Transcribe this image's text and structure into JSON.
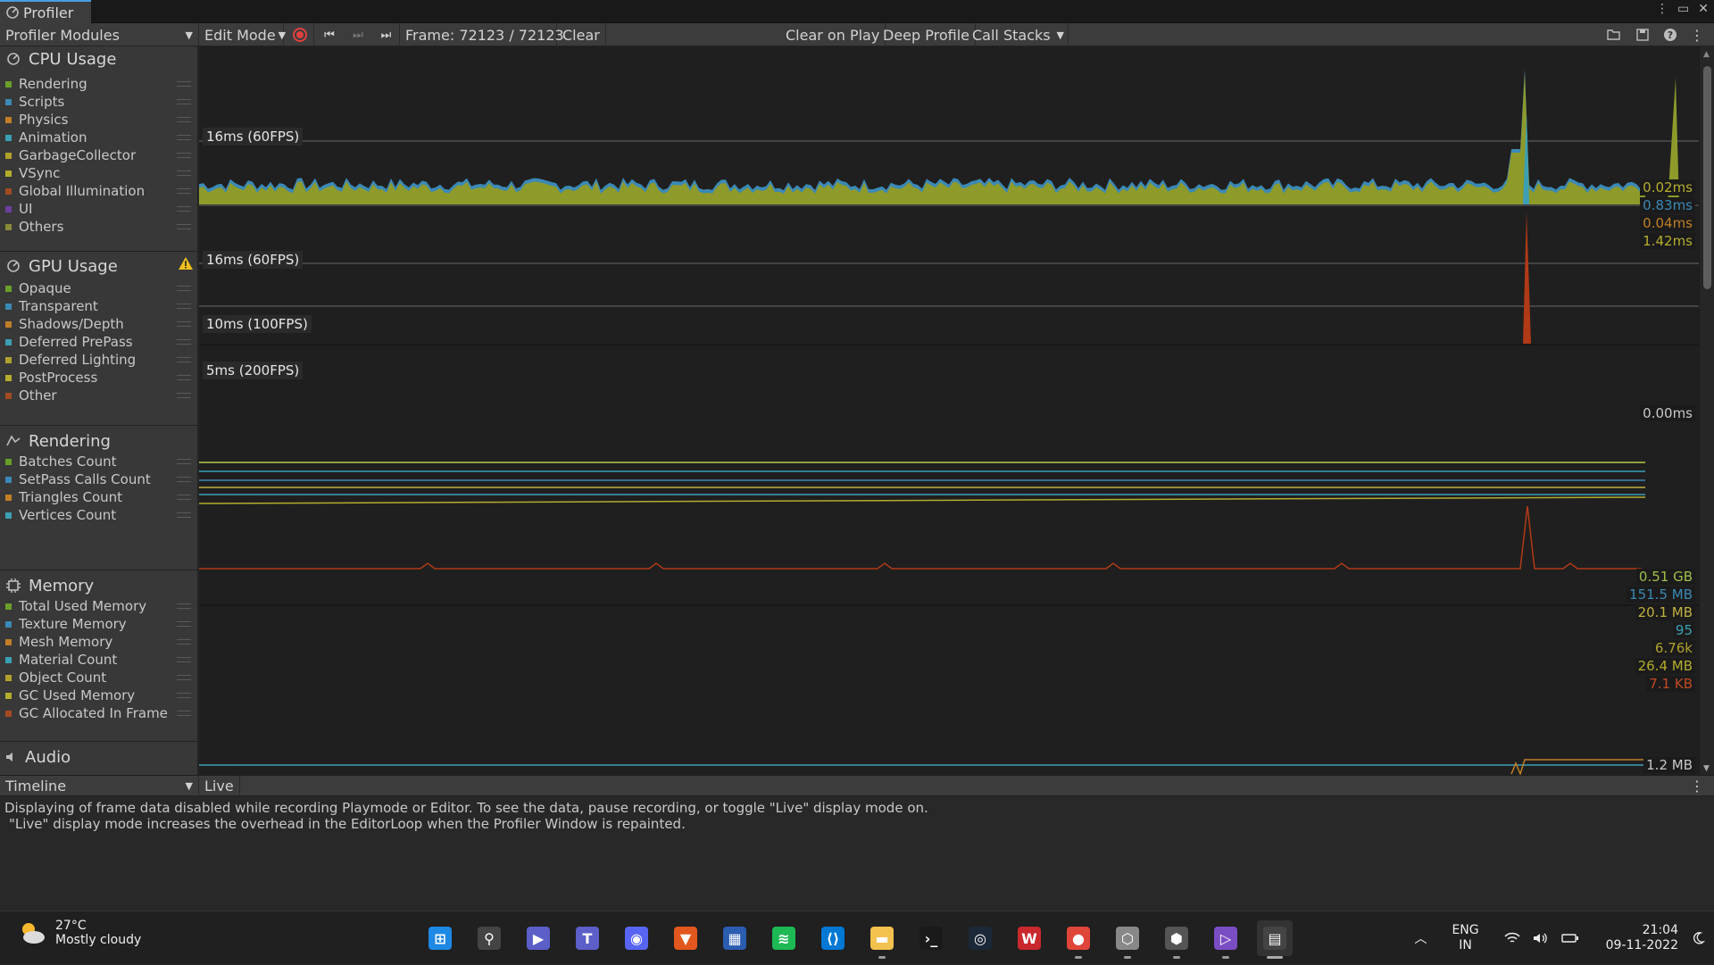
{
  "window": {
    "tab_title": "Profiler"
  },
  "toolbar": {
    "modules_label": "Profiler Modules",
    "mode_label": "Edit Mode",
    "frame_label": "Frame: 72123 / 72123",
    "clear_label": "Clear",
    "clear_on_play_label": "Clear on Play",
    "deep_profile_label": "Deep Profile",
    "call_stacks_label": "Call Stacks"
  },
  "modules": {
    "cpu": {
      "title": "CPU Usage",
      "items": [
        {
          "label": "Rendering",
          "color": "#6a9f2a"
        },
        {
          "label": "Scripts",
          "color": "#3b89b6"
        },
        {
          "label": "Physics",
          "color": "#c07f27"
        },
        {
          "label": "Animation",
          "color": "#3b9fb5"
        },
        {
          "label": "GarbageCollector",
          "color": "#b0a02c"
        },
        {
          "label": "VSync",
          "color": "#b4ad2e"
        },
        {
          "label": "Global Illumination",
          "color": "#a34a21"
        },
        {
          "label": "UI",
          "color": "#6b3fa0"
        },
        {
          "label": "Others",
          "color": "#8a8a3a"
        }
      ]
    },
    "gpu": {
      "title": "GPU Usage",
      "items": [
        {
          "label": "Opaque",
          "color": "#6a9f2a"
        },
        {
          "label": "Transparent",
          "color": "#3b89b6"
        },
        {
          "label": "Shadows/Depth",
          "color": "#c07f27"
        },
        {
          "label": "Deferred PrePass",
          "color": "#3b9fb5"
        },
        {
          "label": "Deferred Lighting",
          "color": "#b0a02c"
        },
        {
          "label": "PostProcess",
          "color": "#b4ad2e"
        },
        {
          "label": "Other",
          "color": "#a34a21"
        }
      ]
    },
    "rendering": {
      "title": "Rendering",
      "items": [
        {
          "label": "Batches Count",
          "color": "#6a9f2a"
        },
        {
          "label": "SetPass Calls Count",
          "color": "#3b89b6"
        },
        {
          "label": "Triangles Count",
          "color": "#c07f27"
        },
        {
          "label": "Vertices Count",
          "color": "#3b9fb5"
        }
      ]
    },
    "memory": {
      "title": "Memory",
      "items": [
        {
          "label": "Total Used Memory",
          "color": "#6a9f2a"
        },
        {
          "label": "Texture Memory",
          "color": "#3b89b6"
        },
        {
          "label": "Mesh Memory",
          "color": "#c07f27"
        },
        {
          "label": "Material Count",
          "color": "#3b9fb5"
        },
        {
          "label": "Object Count",
          "color": "#b0a02c"
        },
        {
          "label": "GC Used Memory",
          "color": "#b4ad2e"
        },
        {
          "label": "GC Allocated In Frame",
          "color": "#a34a21"
        }
      ]
    },
    "audio": {
      "title": "Audio"
    }
  },
  "graphs": {
    "cpu_ref": "16ms (60FPS)",
    "cpu_values": [
      {
        "text": "0.02ms",
        "color": "#b4ad2e"
      },
      {
        "text": "0.83ms",
        "color": "#3b89b6"
      },
      {
        "text": "0.04ms",
        "color": "#c07f27"
      },
      {
        "text": "1.42ms",
        "color": "#b4ad2e"
      }
    ],
    "gpu_refs": [
      "16ms (60FPS)",
      "10ms (100FPS)",
      "5ms (200FPS)"
    ],
    "gpu_value": {
      "text": "0.00ms",
      "color": "#c8c8c8"
    },
    "memory_values": [
      {
        "text": "0.51 GB",
        "color": "#9fbf4a"
      },
      {
        "text": "151.5 MB",
        "color": "#3b89b6"
      },
      {
        "text": "20.1 MB",
        "color": "#c0b040"
      },
      {
        "text": "95",
        "color": "#3b9fb5"
      },
      {
        "text": "6.76k",
        "color": "#b0a02c"
      },
      {
        "text": "26.4 MB",
        "color": "#b4ad2e"
      },
      {
        "text": "7.1 KB",
        "color": "#c04a21"
      }
    ],
    "audio_value": {
      "text": "1.2 MB",
      "color": "#c8c8c8"
    }
  },
  "details": {
    "view_label": "Timeline",
    "live_label": "Live",
    "message_line1": "Displaying of frame data disabled while recording Playmode or Editor. To see the data, pause recording, or toggle \"Live\" display mode on.",
    "message_line2": "\"Live\" display mode increases the overhead in the EditorLoop when the Profiler Window is repainted."
  },
  "taskbar": {
    "weather_temp": "27°C",
    "weather_desc": "Mostly cloudy",
    "lang": "ENG",
    "region": "IN",
    "time": "21:04",
    "date": "09-11-2022",
    "apps": [
      "start-icon",
      "search-icon",
      "meet-icon",
      "teams-icon",
      "discord-icon",
      "brave-icon",
      "store-icon",
      "spotify-icon",
      "vscode-icon",
      "explorer-icon",
      "terminal-icon",
      "steam-icon",
      "wps-icon",
      "chrome-icon",
      "unity-hub-icon",
      "unity-icon",
      "visual-studio-icon",
      "unity-profiler-icon"
    ]
  }
}
